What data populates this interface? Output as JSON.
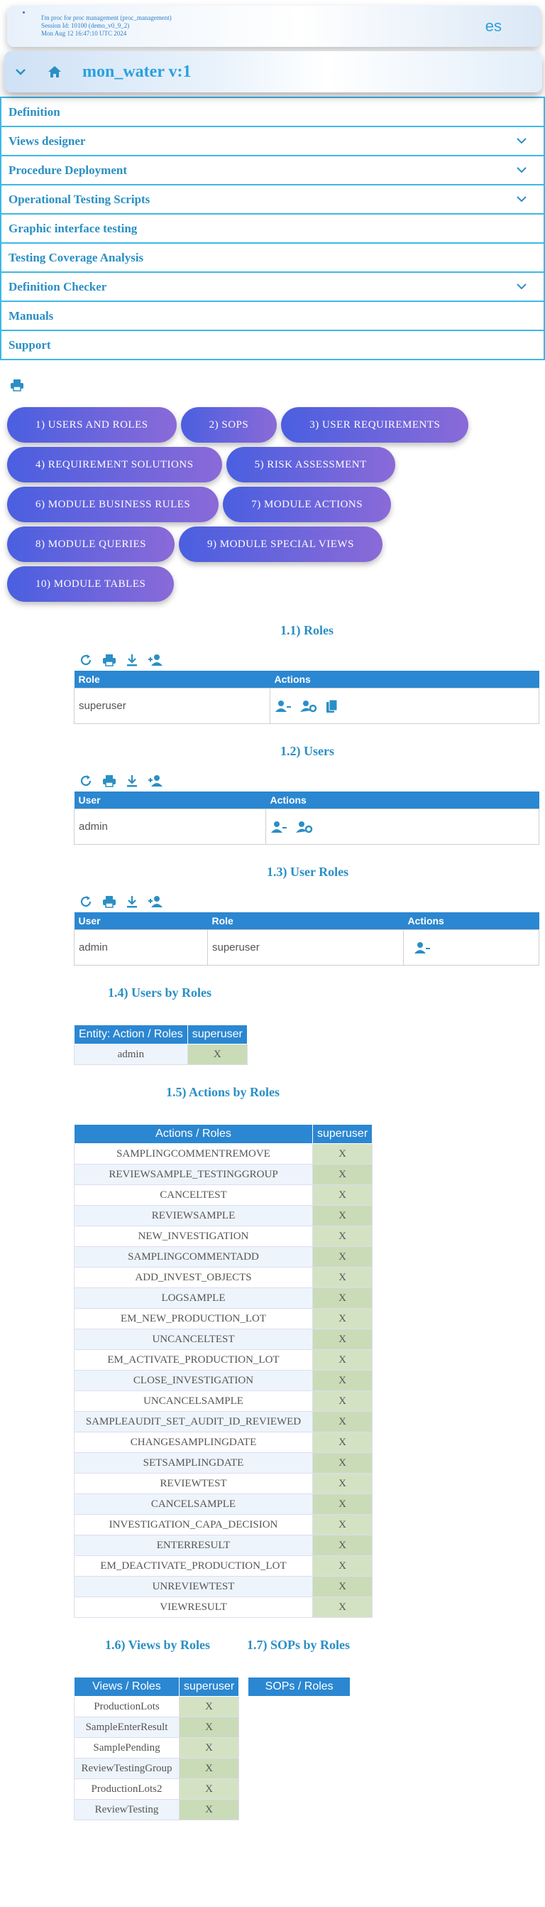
{
  "session": {
    "line1": "I'm proc for proc management (proc_management)",
    "line2": "Session Id: 10100 (demo_v0_9_2)",
    "line3": "Mon Aug 12 16:47:10 UTC 2024",
    "language": "es"
  },
  "procedure": {
    "title": "mon_water v:1"
  },
  "menu": [
    {
      "label": "Definition",
      "expandable": false
    },
    {
      "label": "Views designer",
      "expandable": true
    },
    {
      "label": "Procedure Deployment",
      "expandable": true
    },
    {
      "label": "Operational Testing Scripts",
      "expandable": true
    },
    {
      "label": "Graphic interface testing",
      "expandable": false
    },
    {
      "label": "Testing Coverage Analysis",
      "expandable": false
    },
    {
      "label": "Definition Checker",
      "expandable": true
    },
    {
      "label": "Manuals",
      "expandable": false
    },
    {
      "label": "Support",
      "expandable": false
    }
  ],
  "chips": [
    "1) USERS AND ROLES",
    "2) SOPS",
    "3) USER REQUIREMENTS",
    "4) REQUIREMENT SOLUTIONS",
    "5) RISK ASSESSMENT",
    "6) MODULE BUSINESS RULES",
    "7) MODULE ACTIONS",
    "8) MODULE QUERIES",
    "9) MODULE SPECIAL VIEWS",
    "10) MODULE TABLES"
  ],
  "roles": {
    "title": "1.1) Roles",
    "col_role": "Role",
    "col_actions": "Actions",
    "rows": [
      "superuser"
    ]
  },
  "users": {
    "title": "1.2) Users",
    "col_user": "User",
    "col_actions": "Actions",
    "rows": [
      "admin"
    ]
  },
  "user_roles": {
    "title": "1.3) User Roles",
    "col_user": "User",
    "col_role": "Role",
    "col_actions": "Actions",
    "rows": [
      {
        "user": "admin",
        "role": "superuser"
      }
    ]
  },
  "users_by_roles": {
    "title": "1.4) Users by Roles",
    "corner": "Entity: Action / Roles",
    "role": "superuser",
    "rows": [
      {
        "name": "admin",
        "mark": "X"
      }
    ]
  },
  "actions_by_roles": {
    "title": "1.5) Actions by Roles",
    "corner": "Actions / Roles",
    "role": "superuser",
    "mark": "X",
    "rows": [
      "SAMPLINGCOMMENTREMOVE",
      "REVIEWSAMPLE_TESTINGGROUP",
      "CANCELTEST",
      "REVIEWSAMPLE",
      "NEW_INVESTIGATION",
      "SAMPLINGCOMMENTADD",
      "ADD_INVEST_OBJECTS",
      "LOGSAMPLE",
      "EM_NEW_PRODUCTION_LOT",
      "UNCANCELTEST",
      "EM_ACTIVATE_PRODUCTION_LOT",
      "CLOSE_INVESTIGATION",
      "UNCANCELSAMPLE",
      "SAMPLEAUDIT_SET_AUDIT_ID_REVIEWED",
      "CHANGESAMPLINGDATE",
      "SETSAMPLINGDATE",
      "REVIEWTEST",
      "CANCELSAMPLE",
      "INVESTIGATION_CAPA_DECISION",
      "ENTERRESULT",
      "EM_DEACTIVATE_PRODUCTION_LOT",
      "UNREVIEWTEST",
      "VIEWRESULT"
    ]
  },
  "views_by_roles": {
    "title": "1.6) Views by Roles",
    "corner": "Views / Roles",
    "role": "superuser",
    "mark": "X",
    "rows": [
      "ProductionLots",
      "SampleEnterResult",
      "SamplePending",
      "ReviewTestingGroup",
      "ProductionLots2",
      "ReviewTesting"
    ]
  },
  "sops_by_roles": {
    "title": "1.7) SOPs by Roles",
    "corner": "SOPs / Roles"
  },
  "colors": {
    "accent": "#2a8fc4",
    "table_header": "#2b87d1",
    "chip_start": "#4a5fe0",
    "chip_end": "#8a6ad8",
    "mark_cell": "#d4e2c4"
  }
}
